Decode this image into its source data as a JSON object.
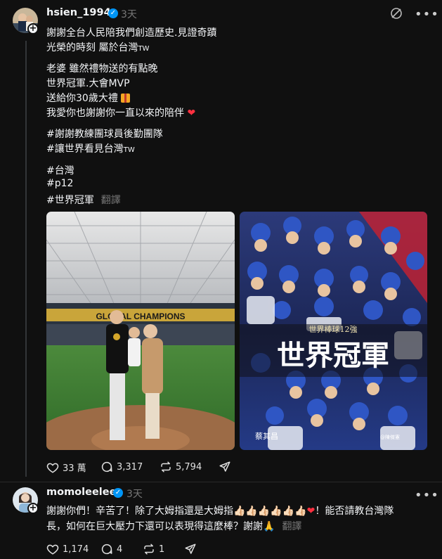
{
  "post": {
    "username": "hsien_1994",
    "time": "3天",
    "lines": [
      "謝謝全台人民陪我們創造歷史.見證奇蹟",
      "光榮的時刻 屬於台灣",
      "老婆 雖然禮物送的有點晚",
      "世界冠軍.大會MVP",
      "送給你30歲大禮",
      "我愛你也謝謝你一直以來的陪伴",
      "#謝謝教練團球員後勤團隊",
      "#讓世界看見台灣",
      "#台灣",
      "#p12",
      "#世界冠軍"
    ],
    "tw_tag": "TW",
    "translate": "翻譯",
    "photo1_banner": "GLOBAL CHAMPIONS",
    "photo2_title": "世界冠軍",
    "photo2_subtitle": "世界棒球12強",
    "photo2_name": "蔡其昌",
    "photo2_footer": "@陳傑憲",
    "likes": "33 萬",
    "replies": "3,317",
    "reposts": "5,794"
  },
  "reply": {
    "username": "momoleelee",
    "time": "3天",
    "line1": "謝謝你們！辛苦了！除了大姆指還是大姆指👍🏻👍🏻👍🏻👍🏻👍🏻👍🏻",
    "line1_end": "！能否請教台灣隊",
    "line2": "長，如何在巨大壓力下還可以表現得這麼棒？謝謝🙏",
    "translate": "翻譯",
    "likes": "1,174",
    "replies": "4",
    "reposts": "1"
  },
  "icons": [
    "heart-icon",
    "comment-icon",
    "repost-icon",
    "share-icon",
    "more-icon",
    "mute-icon",
    "verified-icon",
    "gift-icon",
    "plus-icon"
  ],
  "colors": {
    "background": "#101010",
    "verified": "#0095f6",
    "heart": "#ff3040",
    "secondary": "#777777"
  }
}
